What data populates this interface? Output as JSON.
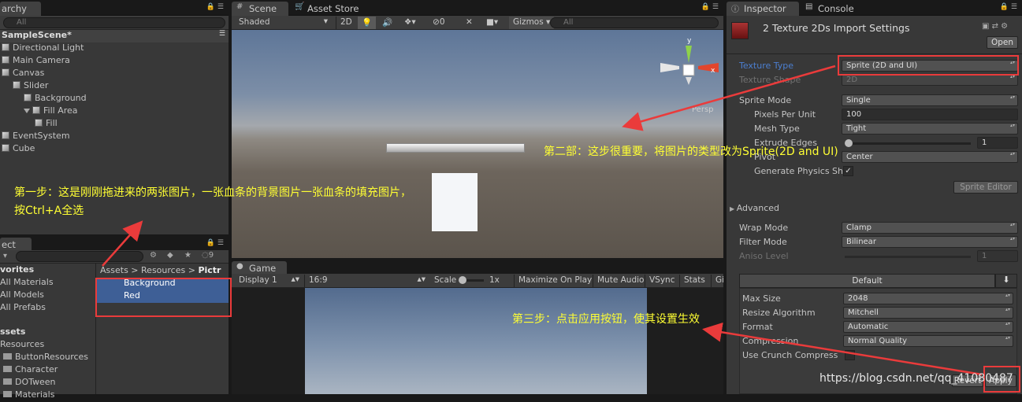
{
  "hierarchy": {
    "tab": "archy",
    "search_placeholder": "All",
    "scene": "SampleScene*",
    "items": [
      {
        "label": "Directional Light",
        "indent": 0
      },
      {
        "label": "Main Camera",
        "indent": 0
      },
      {
        "label": "Canvas",
        "indent": 0
      },
      {
        "label": "Slider",
        "indent": 1
      },
      {
        "label": "Background",
        "indent": 2
      },
      {
        "label": "Fill Area",
        "indent": 2
      },
      {
        "label": "Fill",
        "indent": 3
      },
      {
        "label": "EventSystem",
        "indent": 0
      },
      {
        "label": "Cube",
        "indent": 0
      }
    ]
  },
  "project": {
    "tab": "ect",
    "count": "9",
    "favorites": "vorites",
    "fav_items": [
      "All Materials",
      "All Models",
      "All Prefabs"
    ],
    "assets_header": "ssets",
    "asset_tree": [
      "Resources",
      "ButtonResources",
      "Character",
      "DOTween",
      "Materials"
    ],
    "breadcrumb": [
      "Assets",
      "Resources",
      "Pictr"
    ],
    "files": [
      "Background",
      "Red"
    ]
  },
  "scene": {
    "tabs": [
      "Scene",
      "Asset Store"
    ],
    "shaded": "Shaded",
    "mode_2d": "2D",
    "hidden_count": "0",
    "gizmos": "Gizmos",
    "search_placeholder": "All",
    "persp": "Persp"
  },
  "game": {
    "tab": "Game",
    "display": "Display 1",
    "aspect": "16:9",
    "scale_label": "Scale",
    "scale_value": "1x",
    "options": [
      "Maximize On Play",
      "Mute Audio",
      "VSync",
      "Stats",
      "Gi"
    ]
  },
  "inspector": {
    "tabs": [
      "Inspector",
      "Console"
    ],
    "title": "2 Texture 2Ds Import Settings",
    "open": "Open",
    "texture_type_label": "Texture Type",
    "texture_type": "Sprite (2D and UI)",
    "texture_shape_label": "Texture Shape",
    "texture_shape": "2D",
    "sprite_mode_label": "Sprite Mode",
    "sprite_mode": "Single",
    "ppu_label": "Pixels Per Unit",
    "ppu": "100",
    "mesh_type_label": "Mesh Type",
    "mesh_type": "Tight",
    "extrude_label": "Extrude Edges",
    "extrude": "1",
    "pivot_label": "Pivot",
    "pivot": "Center",
    "physics_label": "Generate Physics Sh",
    "sprite_editor": "Sprite Editor",
    "advanced": "Advanced",
    "wrap_label": "Wrap Mode",
    "wrap": "Clamp",
    "filter_label": "Filter Mode",
    "filter": "Bilinear",
    "aniso_label": "Aniso Level",
    "aniso": "1",
    "platform": "Default",
    "max_size_label": "Max Size",
    "max_size": "2048",
    "resize_label": "Resize Algorithm",
    "resize": "Mitchell",
    "format_label": "Format",
    "format": "Automatic",
    "compression_label": "Compression",
    "compression": "Normal Quality",
    "crunch_label": "Use Crunch Compress",
    "revert": "Revert",
    "apply": "Apply"
  },
  "annotations": {
    "step1_line1": "第一步：这是刚刚拖进来的两张图片，一张血条的背景图片一张血条的填充图片，",
    "step1_line2": "按Ctrl+A全选",
    "step2": "第二部：这步很重要，将图片的类型改为Sprite(2D and UI)",
    "step3": "第三步：点击应用按钮，使其设置生效"
  },
  "watermark": "https://blog.csdn.net/qq_41080487",
  "colors": {
    "annotation": "#ffff33",
    "highlight": "#ea3b3b",
    "selection": "#3e5f96",
    "label_blue": "#4c7fd1"
  }
}
